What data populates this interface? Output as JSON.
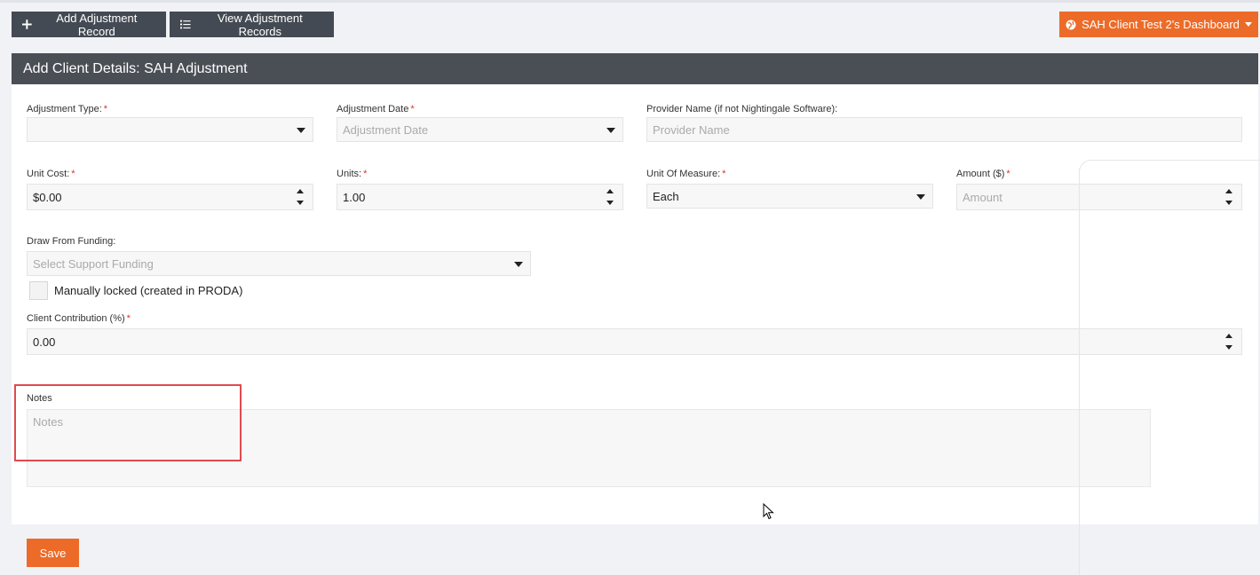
{
  "toolbar": {
    "add_label": "Add Adjustment Record",
    "add_icon": "plus-icon",
    "view_label": "View Adjustment Records",
    "view_icon": "list-icon",
    "dashboard_label": "SAH Client Test 2's Dashboard",
    "dashboard_icon": "globe-icon"
  },
  "panel": {
    "title": "Add Client Details: SAH Adjustment"
  },
  "form": {
    "adjustment_type": {
      "label": "Adjustment Type:",
      "value": ""
    },
    "adjustment_date": {
      "label": "Adjustment Date",
      "placeholder": "Adjustment Date"
    },
    "provider_name": {
      "label": "Provider Name (if not Nightingale Software):",
      "placeholder": "Provider Name"
    },
    "unit_cost": {
      "label": "Unit Cost:",
      "value": "$0.00"
    },
    "units": {
      "label": "Units:",
      "value": "1.00"
    },
    "unit_of_measure": {
      "label": "Unit Of Measure:",
      "value": "Each"
    },
    "amount": {
      "label": "Amount ($)",
      "placeholder": "Amount"
    },
    "draw_from_funding": {
      "label": "Draw From Funding:",
      "placeholder": "Select Support Funding"
    },
    "manually_locked": {
      "label": "Manually locked (created in PRODA)",
      "checked": false
    },
    "client_contribution": {
      "label": "Client Contribution (%)",
      "value": "0.00"
    },
    "notes": {
      "label": "Notes",
      "placeholder": "Notes"
    },
    "required_mark": "*"
  },
  "footer": {
    "save_label": "Save"
  },
  "colors": {
    "accent": "#ec6b28",
    "dark_button": "#444a53",
    "header": "#4a4e55",
    "required": "#d9342b",
    "highlight": "#e04a4f"
  }
}
